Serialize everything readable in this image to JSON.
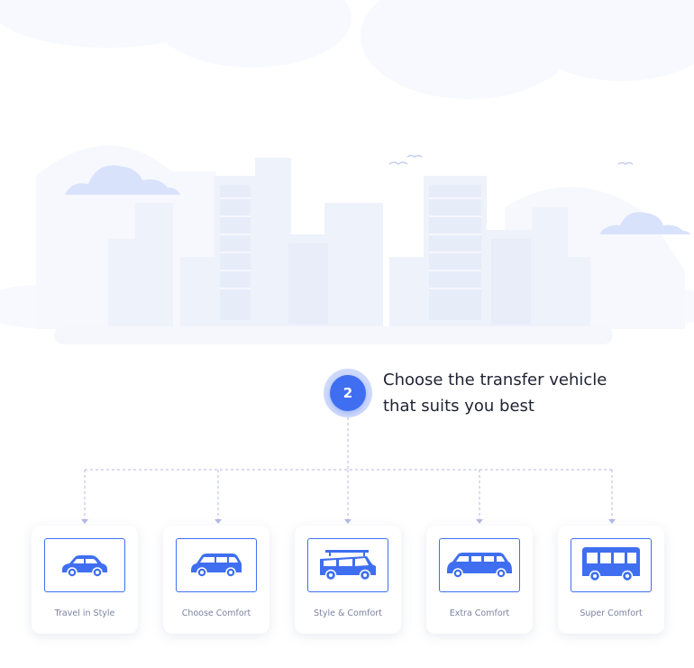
{
  "step": {
    "number": "2",
    "title_line1": "Choose the transfer vehicle",
    "title_line2": "that suits you best"
  },
  "vehicles": [
    {
      "label": "Travel in Style",
      "icon": "sedan-car-icon"
    },
    {
      "label": "Choose Comfort",
      "icon": "hatchback-car-icon"
    },
    {
      "label": "Style & Comfort",
      "icon": "suv-roof-rack-icon"
    },
    {
      "label": "Extra Comfort",
      "icon": "limousine-icon"
    },
    {
      "label": "Super Comfort",
      "icon": "bus-icon"
    }
  ],
  "colors": {
    "accent": "#3f6ff0",
    "step_ring": "#cfd9fb",
    "connector": "#b3b9e6",
    "city_fill": "#f2f5fc",
    "cloud_fill": "#d9e2fb",
    "text": "#1f2233",
    "label": "#7d83a0"
  }
}
